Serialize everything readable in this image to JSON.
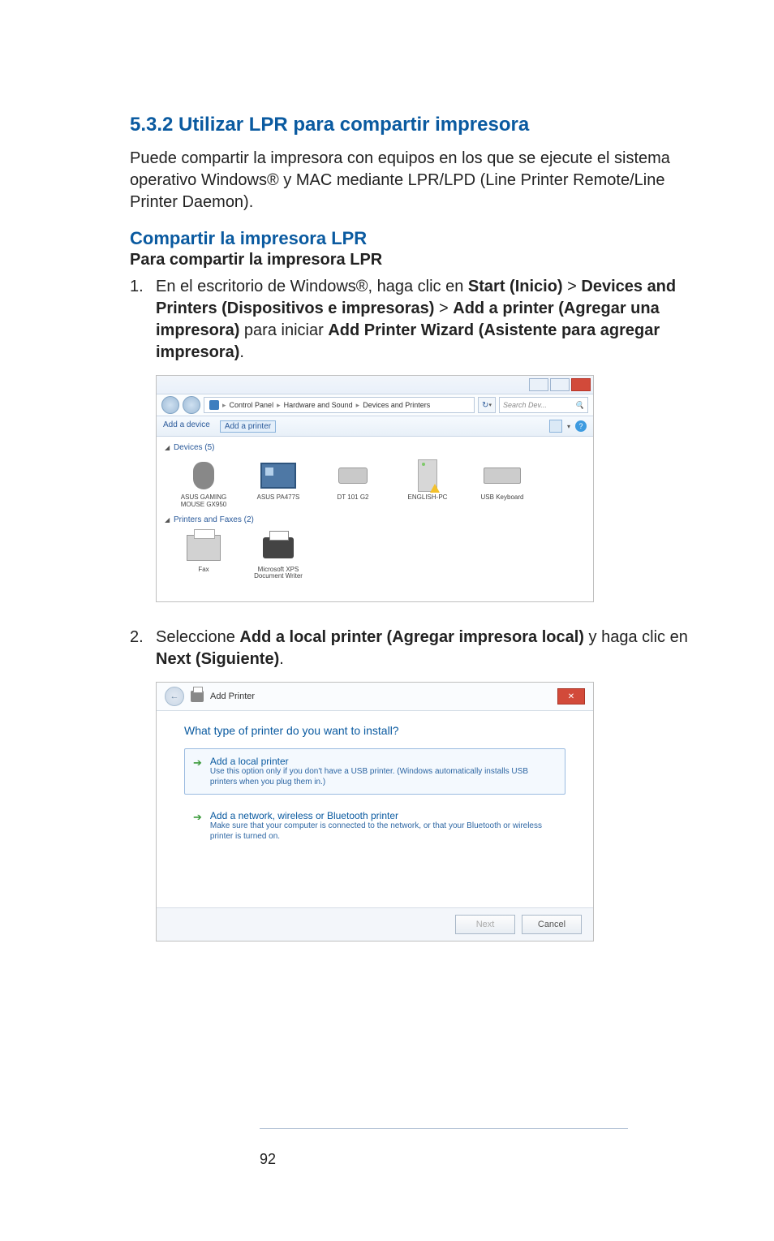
{
  "section_title": "5.3.2 Utilizar LPR para compartir impresora",
  "intro": "Puede compartir la impresora con equipos en los que se ejecute el sistema operativo Windows® y MAC mediante LPR/LPD (Line Printer Remote/Line Printer Daemon).",
  "sub_blue": "Compartir la impresora LPR",
  "sub_black": "Para compartir la impresora LPR",
  "step1": {
    "num": "1.",
    "p1": "En el escritorio de Windows®, haga clic en ",
    "b1": "Start (Inicio)",
    "gt1": " > ",
    "b2": "Devices and Printers (Dispositivos e impresoras)",
    "gt2": " > ",
    "b3": "Add a printer (Agregar una impresora)",
    "p2": " para iniciar ",
    "b4": "Add Printer Wizard (Asistente para agregar impresora)",
    "dot": "."
  },
  "step2": {
    "num": "2.",
    "p1": "Seleccione ",
    "b1": "Add a local printer (Agregar impresora local)",
    "p2": " y haga clic en ",
    "b2": "Next (Siguiente)",
    "dot": "."
  },
  "shot1": {
    "breadcrumb": {
      "root": "Control Panel",
      "lvl1": "Hardware and Sound",
      "lvl2": "Devices and Printers"
    },
    "search_placeholder": "Search Dev...",
    "toolbar": {
      "add_device": "Add a device",
      "add_printer": "Add a printer"
    },
    "group_devices": "Devices (5)",
    "group_printers": "Printers and Faxes (2)",
    "devices": [
      {
        "name": "ASUS GAMING MOUSE GX950"
      },
      {
        "name": "ASUS PA477S"
      },
      {
        "name": "DT 101 G2"
      },
      {
        "name": "ENGLISH-PC"
      },
      {
        "name": "USB Keyboard"
      }
    ],
    "printers": [
      {
        "name": "Fax"
      },
      {
        "name": "Microsoft XPS Document Writer"
      }
    ]
  },
  "shot2": {
    "title": "Add Printer",
    "heading": "What type of printer do you want to install?",
    "opt1": {
      "title": "Add a local printer",
      "desc": "Use this option only if you don't have a USB printer. (Windows automatically installs USB printers when you plug them in.)"
    },
    "opt2": {
      "title": "Add a network, wireless or Bluetooth printer",
      "desc": "Make sure that your computer is connected to the network, or that your Bluetooth or wireless printer is turned on."
    },
    "next": "Next",
    "cancel": "Cancel"
  },
  "page_number": "92"
}
